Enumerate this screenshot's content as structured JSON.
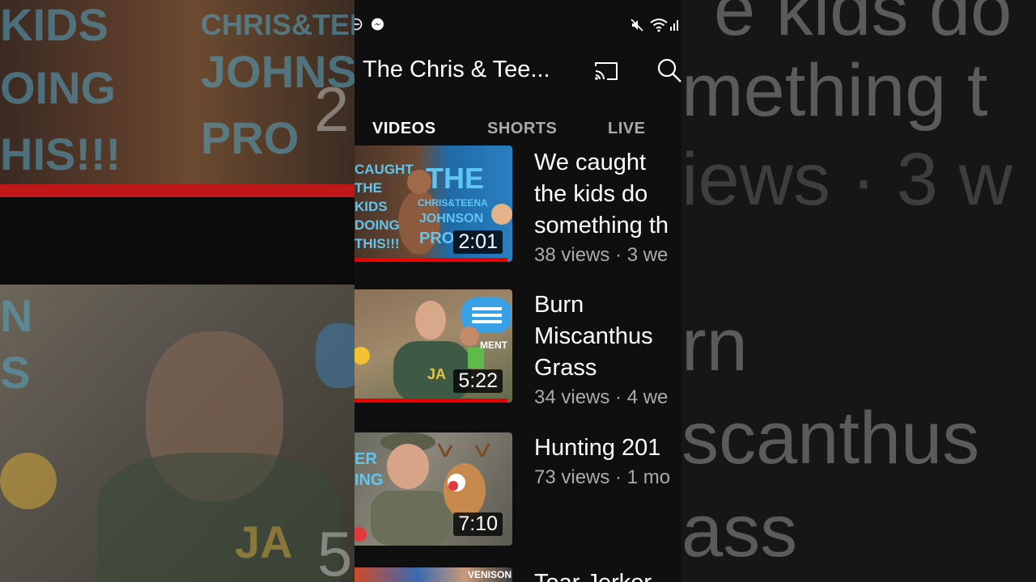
{
  "status": {
    "left_icons": [
      "do-not-disturb-icon",
      "messenger-icon"
    ],
    "right_icons": [
      "mute-icon",
      "wifi-icon",
      "signal-icon"
    ]
  },
  "header": {
    "channel_title": "The Chris & Tee...",
    "cast_icon": "cast-icon",
    "search_icon": "search-icon"
  },
  "tabs": [
    {
      "label": "VIDEOS",
      "active": true
    },
    {
      "label": "SHORTS",
      "active": false
    },
    {
      "label": "LIVE",
      "active": false
    }
  ],
  "videos": [
    {
      "title": "We caught\nthe kids do\nsomething th",
      "meta": "38 views · 3 we",
      "duration": "2:01",
      "thumb_text": [
        "CAUGHT",
        "THE",
        "KIDS",
        "DOING",
        "THIS!!!",
        "THE",
        "CHRIS&TEENA",
        "JOHNSON",
        "PRO"
      ],
      "watched_fraction": 0.97
    },
    {
      "title": "Burn\nMiscanthus\nGrass",
      "meta": "34 views · 4 we",
      "duration": "5:22",
      "thumb_text": [
        "MENT",
        "JA"
      ],
      "watched_fraction": 0.97
    },
    {
      "title": "Hunting 201",
      "meta": "73 views · 1 mo",
      "duration": "7:10",
      "thumb_text": [
        "ER",
        "ING"
      ],
      "watched_fraction": 0
    },
    {
      "title": "Tear Jerker",
      "meta": "",
      "duration": "",
      "thumb_text": [
        "VENISON"
      ],
      "watched_fraction": 0
    }
  ],
  "background": {
    "left_text": [
      "KIDS",
      "OING",
      "HIS!!!",
      "CHRIS&TEE",
      "JOHNSO",
      "PRO",
      "2",
      "N",
      "S",
      "JA",
      "5"
    ],
    "right_text": [
      "e kids do",
      "mething t",
      "iews · 3 w",
      "rn",
      "scanthus",
      "ass"
    ]
  }
}
